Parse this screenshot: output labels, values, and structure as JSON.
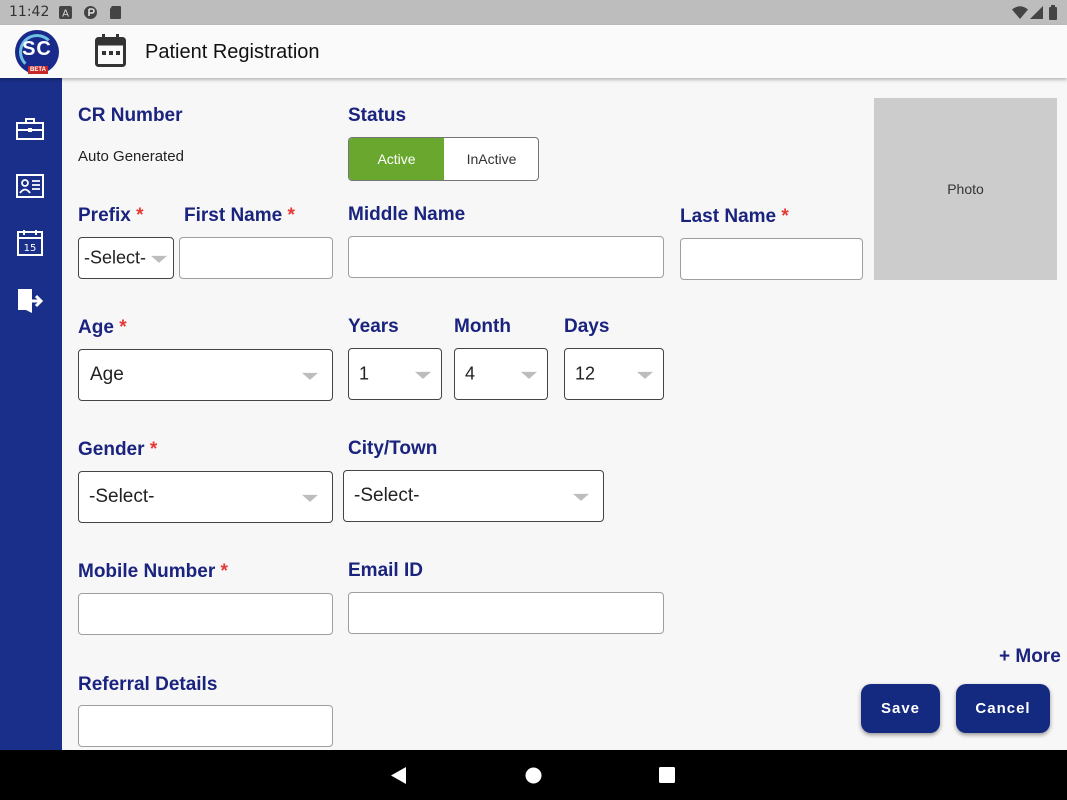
{
  "status_bar": {
    "time": "11:42"
  },
  "app": {
    "logo_text": "SC",
    "logo_badge": "BETA",
    "title": "Patient Registration"
  },
  "sidebar": {
    "items": [
      "briefcase-icon",
      "id-card-icon",
      "calendar-icon",
      "logout-icon"
    ]
  },
  "form": {
    "cr_number": {
      "label": "CR Number",
      "value": "Auto Generated"
    },
    "status": {
      "label": "Status",
      "options": [
        "Active",
        "InActive"
      ],
      "selected": "Active"
    },
    "prefix": {
      "label": "Prefix",
      "required": "*",
      "value": "-Select-"
    },
    "first_name": {
      "label": "First Name",
      "required": "*",
      "value": ""
    },
    "middle_name": {
      "label": "Middle Name",
      "value": ""
    },
    "last_name": {
      "label": "Last Name",
      "required": "*",
      "value": ""
    },
    "photo": {
      "label": "Photo"
    },
    "age": {
      "label": "Age",
      "required": "*",
      "value": "Age"
    },
    "years": {
      "label": "Years",
      "value": "1"
    },
    "month": {
      "label": "Month",
      "value": "4"
    },
    "days": {
      "label": "Days",
      "value": "12"
    },
    "gender": {
      "label": "Gender",
      "required": "*",
      "value": "-Select-"
    },
    "city": {
      "label": "City/Town",
      "value": "-Select-"
    },
    "mobile": {
      "label": "Mobile Number",
      "required": "*",
      "value": ""
    },
    "email": {
      "label": "Email ID",
      "value": ""
    },
    "referral": {
      "label": "Referral Details",
      "value": ""
    }
  },
  "actions": {
    "more": "+ More",
    "save": "Save",
    "cancel": "Cancel"
  },
  "colors": {
    "primary": "#1a2f8a",
    "active_green": "#6aa72e",
    "required_red": "#e53935",
    "label_navy": "#1a237e"
  }
}
